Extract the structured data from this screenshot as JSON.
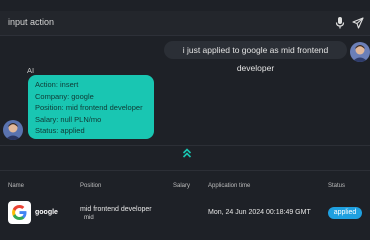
{
  "input": {
    "value": "input action",
    "mic_icon": "microphone-icon",
    "send_icon": "send-icon"
  },
  "chat": {
    "user_message": "i just applied to google as mid frontend developer",
    "ai_label": "AI",
    "ai_lines": [
      "Action: insert",
      "Company: google",
      "Position: mid frontend developer",
      "Salary: null PLN/mo",
      "Status: applied"
    ],
    "collapse_icon": "double-chevron-up-icon"
  },
  "table": {
    "headers": {
      "name": "Name",
      "position": "Position",
      "salary": "Salary",
      "time": "Application time",
      "status": "Status"
    },
    "rows": [
      {
        "company": "google",
        "position": "mid frontend developer",
        "level": "mid",
        "salary": "",
        "time": "Mon, 24 Jun 2024 00:18:49 GMT",
        "status": "applied"
      }
    ]
  },
  "colors": {
    "accent": "#19c6b2",
    "status": "#1fa0e0",
    "background": "#1e2127"
  }
}
